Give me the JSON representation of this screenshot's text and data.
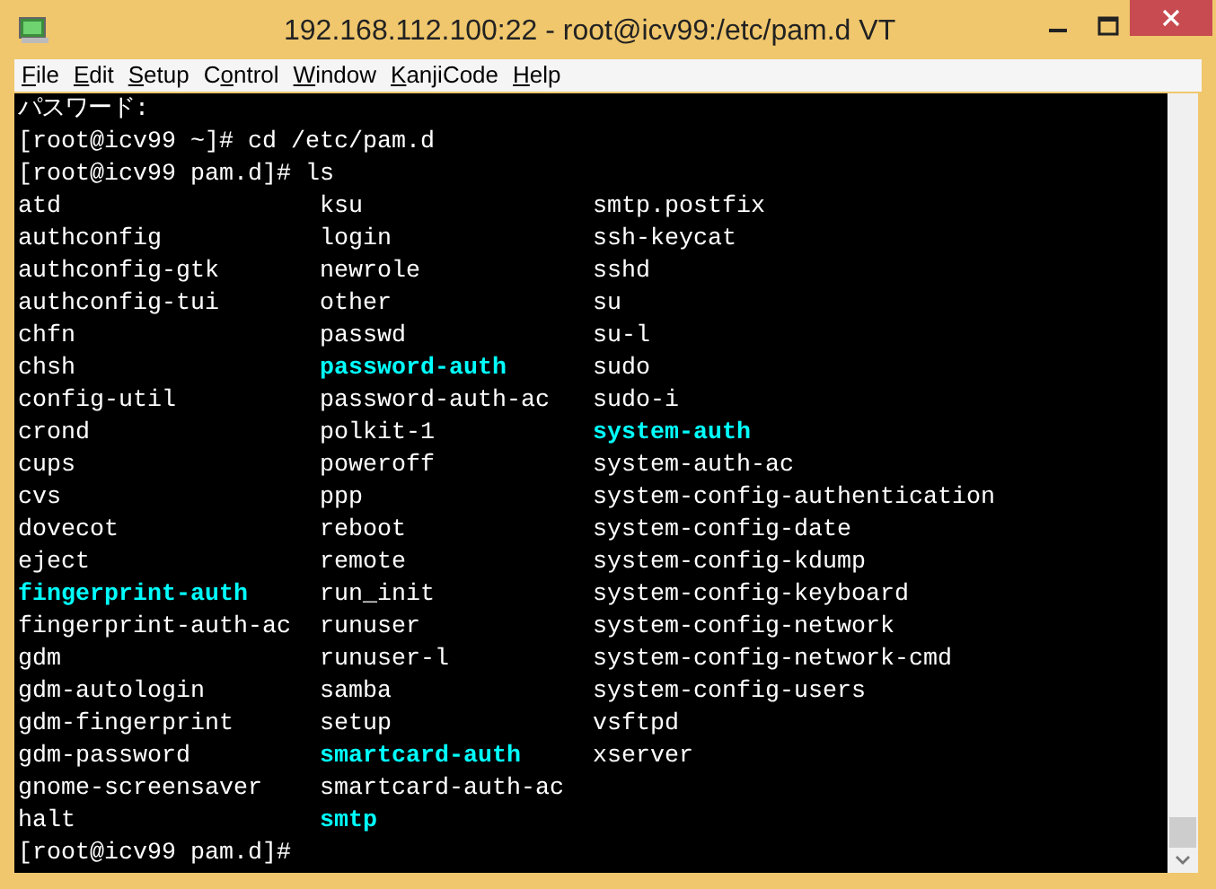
{
  "window": {
    "title": "192.168.112.100:22 - root@icv99:/etc/pam.d VT"
  },
  "menu": [
    {
      "accel": "F",
      "rest": "ile"
    },
    {
      "accel": "E",
      "rest": "dit"
    },
    {
      "accel": "S",
      "rest": "etup"
    },
    {
      "prefix": "C",
      "accel": "o",
      "rest": "ntrol"
    },
    {
      "accel": "W",
      "rest": "indow"
    },
    {
      "accel": "K",
      "rest": "anjiCode"
    },
    {
      "accel": "H",
      "rest": "elp"
    }
  ],
  "terminal": {
    "lines_before": [
      "パスワード:",
      "[root@icv99 ~]# cd /etc/pam.d",
      "[root@icv99 pam.d]# ls"
    ],
    "listing": [
      [
        {
          "text": "atd",
          "highlight": false
        },
        {
          "text": "ksu",
          "highlight": false
        },
        {
          "text": "smtp.postfix",
          "highlight": false
        }
      ],
      [
        {
          "text": "authconfig",
          "highlight": false
        },
        {
          "text": "login",
          "highlight": false
        },
        {
          "text": "ssh-keycat",
          "highlight": false
        }
      ],
      [
        {
          "text": "authconfig-gtk",
          "highlight": false
        },
        {
          "text": "newrole",
          "highlight": false
        },
        {
          "text": "sshd",
          "highlight": false
        }
      ],
      [
        {
          "text": "authconfig-tui",
          "highlight": false
        },
        {
          "text": "other",
          "highlight": false
        },
        {
          "text": "su",
          "highlight": false
        }
      ],
      [
        {
          "text": "chfn",
          "highlight": false
        },
        {
          "text": "passwd",
          "highlight": false
        },
        {
          "text": "su-l",
          "highlight": false
        }
      ],
      [
        {
          "text": "chsh",
          "highlight": false
        },
        {
          "text": "password-auth",
          "highlight": true
        },
        {
          "text": "sudo",
          "highlight": false
        }
      ],
      [
        {
          "text": "config-util",
          "highlight": false
        },
        {
          "text": "password-auth-ac",
          "highlight": false
        },
        {
          "text": "sudo-i",
          "highlight": false
        }
      ],
      [
        {
          "text": "crond",
          "highlight": false
        },
        {
          "text": "polkit-1",
          "highlight": false
        },
        {
          "text": "system-auth",
          "highlight": true
        }
      ],
      [
        {
          "text": "cups",
          "highlight": false
        },
        {
          "text": "poweroff",
          "highlight": false
        },
        {
          "text": "system-auth-ac",
          "highlight": false
        }
      ],
      [
        {
          "text": "cvs",
          "highlight": false
        },
        {
          "text": "ppp",
          "highlight": false
        },
        {
          "text": "system-config-authentication",
          "highlight": false
        }
      ],
      [
        {
          "text": "dovecot",
          "highlight": false
        },
        {
          "text": "reboot",
          "highlight": false
        },
        {
          "text": "system-config-date",
          "highlight": false
        }
      ],
      [
        {
          "text": "eject",
          "highlight": false
        },
        {
          "text": "remote",
          "highlight": false
        },
        {
          "text": "system-config-kdump",
          "highlight": false
        }
      ],
      [
        {
          "text": "fingerprint-auth",
          "highlight": true
        },
        {
          "text": "run_init",
          "highlight": false
        },
        {
          "text": "system-config-keyboard",
          "highlight": false
        }
      ],
      [
        {
          "text": "fingerprint-auth-ac",
          "highlight": false
        },
        {
          "text": "runuser",
          "highlight": false
        },
        {
          "text": "system-config-network",
          "highlight": false
        }
      ],
      [
        {
          "text": "gdm",
          "highlight": false
        },
        {
          "text": "runuser-l",
          "highlight": false
        },
        {
          "text": "system-config-network-cmd",
          "highlight": false
        }
      ],
      [
        {
          "text": "gdm-autologin",
          "highlight": false
        },
        {
          "text": "samba",
          "highlight": false
        },
        {
          "text": "system-config-users",
          "highlight": false
        }
      ],
      [
        {
          "text": "gdm-fingerprint",
          "highlight": false
        },
        {
          "text": "setup",
          "highlight": false
        },
        {
          "text": "vsftpd",
          "highlight": false
        }
      ],
      [
        {
          "text": "gdm-password",
          "highlight": false
        },
        {
          "text": "smartcard-auth",
          "highlight": true
        },
        {
          "text": "xserver",
          "highlight": false
        }
      ],
      [
        {
          "text": "gnome-screensaver",
          "highlight": false
        },
        {
          "text": "smartcard-auth-ac",
          "highlight": false
        }
      ],
      [
        {
          "text": "halt",
          "highlight": false
        },
        {
          "text": "smtp",
          "highlight": true
        }
      ]
    ],
    "lines_after": [
      "[root@icv99 pam.d]#"
    ]
  }
}
